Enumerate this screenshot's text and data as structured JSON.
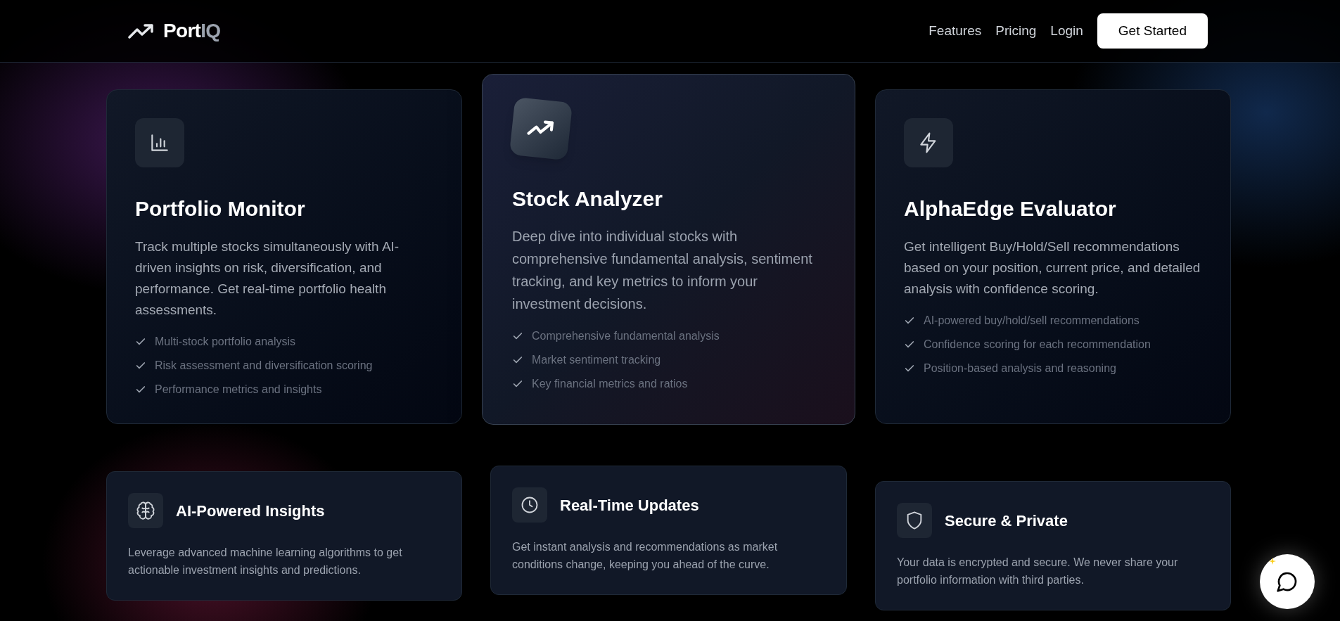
{
  "nav": {
    "logo": {
      "text": "Port",
      "accent": "IQ"
    },
    "links": [
      "Features",
      "Pricing",
      "Login"
    ],
    "cta": "Get Started"
  },
  "features": [
    {
      "title": "Portfolio Monitor",
      "description": "Track multiple stocks simultaneously with AI-driven insights on risk, diversification, and performance. Get real-time portfolio health assessments.",
      "highlighted": false,
      "points": [
        "Multi-stock portfolio analysis",
        "Risk assessment and diversification scoring",
        "Performance metrics and insights"
      ]
    },
    {
      "title": "Stock Analyzer",
      "description": "Deep dive into individual stocks with comprehensive fundamental analysis, sentiment tracking, and key metrics to inform your investment decisions.",
      "highlighted": true,
      "points": [
        "Comprehensive fundamental analysis",
        "Market sentiment tracking",
        "Key financial metrics and ratios"
      ]
    },
    {
      "title": "AlphaEdge Evaluator",
      "description": "Get intelligent Buy/Hold/Sell recommendations based on your position, current price, and detailed analysis with confidence scoring.",
      "highlighted": false,
      "points": [
        "AI-powered buy/hold/sell recommendations",
        "Confidence scoring for each recommendation",
        "Position-based analysis and reasoning"
      ]
    }
  ],
  "benefits": [
    {
      "title": "AI-Powered Insights",
      "description": "Leverage advanced machine learning algorithms to get actionable investment insights and predictions."
    },
    {
      "title": "Real-Time Updates",
      "description": "Get instant analysis and recommendations as market conditions change, keeping you ahead of the curve."
    },
    {
      "title": "Secure & Private",
      "description": "Your data is encrypted and secure. We never share your portfolio information with third parties."
    }
  ]
}
